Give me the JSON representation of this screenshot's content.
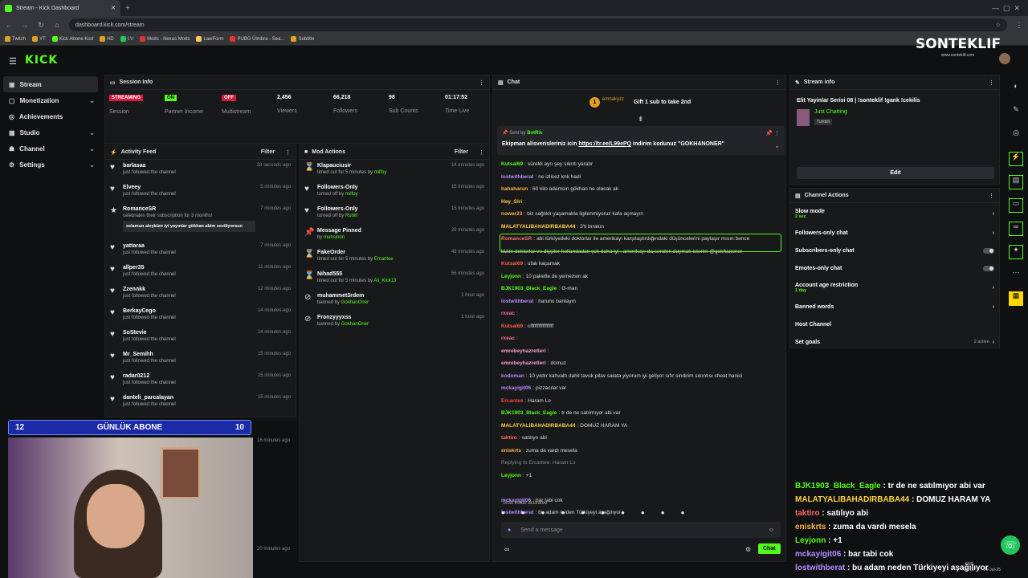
{
  "browser": {
    "tab_title": "Stream - Kick Dashboard",
    "url": "dashboard.kick.com/stream",
    "bookmarks": [
      "Twitch",
      "YT",
      "Kick Abone Kod",
      "HD",
      "I.V",
      "Mods - Nexus Mods",
      "LawForm",
      "PUBG Ülmbra - Sea...",
      "Subtitle"
    ]
  },
  "brand": {
    "logo": "KICK",
    "overlay_logo": "SONTEKLIF",
    "overlay_url": "www.sonteklif.com",
    "accent": "#53fc18"
  },
  "sidebar": {
    "items": [
      {
        "label": "Stream"
      },
      {
        "label": "Monetization"
      },
      {
        "label": "Achievements"
      },
      {
        "label": "Studio"
      },
      {
        "label": "Channel"
      },
      {
        "label": "Settings"
      }
    ]
  },
  "session": {
    "title": "Session Info",
    "stats": [
      {
        "badge": "STREAMING",
        "label": "Session",
        "badge_color": "#e0173c"
      },
      {
        "badge": "ON",
        "label": "Partner Income",
        "badge_color": "#53fc18"
      },
      {
        "badge": "OFF",
        "label": "Multistream",
        "badge_color": "#e0173c"
      },
      {
        "value": "2,456",
        "label": "Viewers"
      },
      {
        "value": "66,218",
        "label": "Followers"
      },
      {
        "value": "98",
        "label": "Sub Counts"
      },
      {
        "value": "01:17:52",
        "label": "Time Live"
      }
    ]
  },
  "activity": {
    "title": "Activity Feed",
    "filter": "Filter",
    "items": [
      {
        "name": "barlasaa",
        "sub": "just followed the channel",
        "time": "28 seconds ago"
      },
      {
        "name": "Elveey",
        "sub": "just followed the channel",
        "time": "5 minutes ago"
      },
      {
        "name": "RomanceSR",
        "sub": "celebrates their subscription for 3 months!",
        "time": "7 minutes ago",
        "msg": "selamun aleyküm iyi yayınlar gökhan abim seviliyorsun"
      },
      {
        "name": "yattaraa",
        "sub": "just followed the channel",
        "time": "7 minutes ago"
      },
      {
        "name": "allper35",
        "sub": "just followed the channel",
        "time": "11 minutes ago"
      },
      {
        "name": "Zzennkk",
        "sub": "just followed the channel",
        "time": "12 minutes ago"
      },
      {
        "name": "BerkayCego",
        "sub": "just followed the channel",
        "time": "14 minutes ago"
      },
      {
        "name": "SoStevie",
        "sub": "just followed the channel",
        "time": "14 minutes ago"
      },
      {
        "name": "Mr_Semihh",
        "sub": "just followed the channel",
        "time": "15 minutes ago"
      },
      {
        "name": "radar0212",
        "sub": "just followed the channel",
        "time": "15 minutes ago"
      },
      {
        "name": "danteli_parcalayan",
        "sub": "just followed the channel",
        "time": "15 minutes ago"
      }
    ],
    "extra_times": [
      "16 minutes ago",
      "20 minutes ago"
    ]
  },
  "mod": {
    "title": "Mod Actions",
    "filter": "Filter",
    "items": [
      {
        "name": "Klapauciusir",
        "sub": "timed out for 5 minutes by ",
        "by": "milfoy",
        "time": "14 minutes ago",
        "icon": "⌛"
      },
      {
        "name": "Followers-Only",
        "sub": "turned off by ",
        "by": "milfoy",
        "time": "15 minutes ago",
        "icon": "♥"
      },
      {
        "name": "Followers-Only",
        "sub": "turned off by ",
        "by": "Rubill",
        "time": "15 minutes ago",
        "icon": "♥"
      },
      {
        "name": "Message Pinned",
        "sub": "by ",
        "by": "muhsinnn",
        "time": "29 minutes ago",
        "icon": "📌"
      },
      {
        "name": "FakeOrder",
        "sub": "timed out for 5 minutes by ",
        "by": "Ercantee",
        "time": "48 minutes ago",
        "icon": "⌛"
      },
      {
        "name": "Nihad555",
        "sub": "timed out for 5 minutes by ",
        "by": "Ali_Kick13",
        "time": "56 minutes ago",
        "icon": "⌛"
      },
      {
        "name": "muhammet3rdem",
        "sub": "banned by ",
        "by": "GokhanOner",
        "time": "1 hour ago",
        "icon": "⊘"
      },
      {
        "name": "Fronzyyyxss",
        "sub": "banned by ",
        "by": "GokhanOner",
        "time": "1 hour ago",
        "icon": "⊘"
      }
    ]
  },
  "chat": {
    "title": "Chat",
    "gift_user": "emnakyzz",
    "gift_count": "1",
    "gift_text": "Gift 1 sub to take 2nd",
    "pinned_by": "Sent by",
    "pinned_user": "BotRix",
    "pinned_msg": "Ekipman alisverisleriniz icin ",
    "pinned_link": "https://tr.ee/L99ePQ",
    "pinned_msg2": " indirim kodunuz \"GOKHANONER\"",
    "messages": [
      {
        "u": "Kutsal69",
        "c": "#53fc18",
        "t": "sürekli ayrı şey sıkrıtı yaratır"
      },
      {
        "u": "lostwithberat",
        "c": "#b58cff",
        "t": "ne izlicez knk hadi"
      },
      {
        "u": "hahaharun",
        "c": "#ffb347",
        "t": "60 kilo adamsın gökhan ne olacak ak"
      },
      {
        "u": "Hey_Siri",
        "c": "#ffd23f",
        "t": ""
      },
      {
        "u": "nowar23",
        "c": "#ffb347",
        "t": "biz sağlıklı yaşamakla ilgilenmiyoruz kafa açmayın"
      },
      {
        "u": "MALATYALIBAHADIRBABA44",
        "c": "#ffd23f",
        "t": "3'ti bırakın"
      },
      {
        "u": "RomanceSR",
        "c": "#ff6b6b",
        "t": "abi türkiyedeki doktorlar ile amerikayı karşılaştırdığındaki düşüncelerini paylaşır mısın bence"
      },
      {
        "u": "",
        "c": "#ddd",
        "t": "bizim doktorlar ve dişçiler hollandadan çok daha iyi , amerikayı da senden duymak isterim @gokhanoner"
      },
      {
        "u": "Kutsal69",
        "c": "#ff5a5a",
        "t": "ufak kaçamak"
      },
      {
        "u": "Leyjonn",
        "c": "#53fc18",
        "t": "10 pakette de yemezsin ak"
      },
      {
        "u": "BJK1903_Black_Eagle",
        "c": "#53fc18",
        "t": "G-man"
      },
      {
        "u": "lostwithberat",
        "c": "#b58cff",
        "t": "harunu banlayın"
      },
      {
        "u": "rxeac",
        "c": "#ff6b9d",
        "t": ""
      },
      {
        "u": "Kutsal69",
        "c": "#ff5a5a",
        "t": "offfffffffffffffff"
      },
      {
        "u": "rxeac",
        "c": "#ff6b9d",
        "t": ""
      },
      {
        "u": "emrebeyhazretleri",
        "c": "#ff9ecf",
        "t": ""
      },
      {
        "u": "emrebeyhazretleri",
        "c": "#ff9ecf",
        "t": "domuz"
      },
      {
        "u": "kodoman",
        "c": "#b58cff",
        "t": "10 yıldır kahvaltı dahil tavuk pilav salata yiyorum iyi geliyor sıfır sindirim sıkıntısı cheat hanici"
      },
      {
        "u": "mckayigit06",
        "c": "#b58cff",
        "t": "pizzacılar var"
      },
      {
        "u": "Ercantee",
        "c": "#ff4444",
        "t": "Haram Lo"
      },
      {
        "u": "BJK1903_Black_Eagle",
        "c": "#53fc18",
        "t": "tr de ne satılmıyor abi var"
      },
      {
        "u": "MALATYALIBAHADIRBABA44",
        "c": "#ffd23f",
        "t": "DOMUZ HARAM YA"
      },
      {
        "u": "taktiro",
        "c": "#ff6b6b",
        "t": "satılıyo abi"
      },
      {
        "u": "eniskrts",
        "c": "#ffb347",
        "t": "zuma da vardı mesela"
      },
      {
        "u": "",
        "c": "#888",
        "t": "Replying to Ercantee: Haram Lo"
      },
      {
        "u": "Leyjonn",
        "c": "#53fc18",
        "t": "+1"
      },
      {
        "u": "",
        "c": "#ddd",
        "t": ""
      },
      {
        "u": "mckayigit06",
        "c": "#b58cff",
        "t": "bar tabi cok"
      },
      {
        "u": "lostwithberat",
        "c": "#b58cff",
        "t": "bu adam neden Türkiyeyi aşağılıyor"
      }
    ],
    "slow_mode": "Slow mode activated",
    "placeholder": "Send a message",
    "send": "Chat"
  },
  "stream_info": {
    "title": "Stream info",
    "stream_title": "Elit Yayinlar Serisi 08 | !sonteklif !gank !cekilis",
    "category": "Just Chatting",
    "tag": "Turkish",
    "edit": "Edit"
  },
  "channel_actions": {
    "title": "Channel Actions",
    "items": [
      {
        "label": "Slow mode",
        "sub": "2 sec",
        "kind": "chev"
      },
      {
        "label": "Followers-only chat",
        "kind": "chev"
      },
      {
        "label": "Subscribers-only chat",
        "kind": "toggle"
      },
      {
        "label": "Emotes-only chat",
        "kind": "toggle"
      },
      {
        "label": "Account age restriction",
        "sub": "1 day",
        "kind": "chev"
      },
      {
        "label": "Banned words",
        "kind": "chev"
      },
      {
        "label": "Host Channel",
        "kind": "none"
      },
      {
        "label": "Set goals",
        "extra": "2 active",
        "kind": "chev"
      }
    ]
  },
  "webcam": {
    "left": "12",
    "label": "GÜNLÜK ABONE",
    "right": "10"
  },
  "overlay_chat": [
    {
      "u": "BJK1903_Black_Eagle",
      "c": "#53fc18",
      "t": " : tr de ne satılmıyor abi var"
    },
    {
      "u": "MALATYALIBAHADIRBABA44",
      "c": "#ffd23f",
      "t": " : DOMUZ HARAM YA"
    },
    {
      "u": "taktiro",
      "c": "#ff6b6b",
      "t": " : satılıyo abi"
    },
    {
      "u": "eniskrts",
      "c": "#ffb347",
      "t": " : zuma da vardı mesela"
    },
    {
      "u": "Leyjonn",
      "c": "#53fc18",
      "t": " : +1"
    },
    {
      "u": "mckayigit06",
      "c": "#b58cff",
      "t": " : bar tabi cok"
    },
    {
      "u": "lostwithberat",
      "c": "#b58cff",
      "t": " : bu adam neden Türkiyeyi aşağılıyor"
    }
  ],
  "taskbar": {
    "lang": "ENG",
    "time": "18:13",
    "date": "29-Jul-25"
  }
}
